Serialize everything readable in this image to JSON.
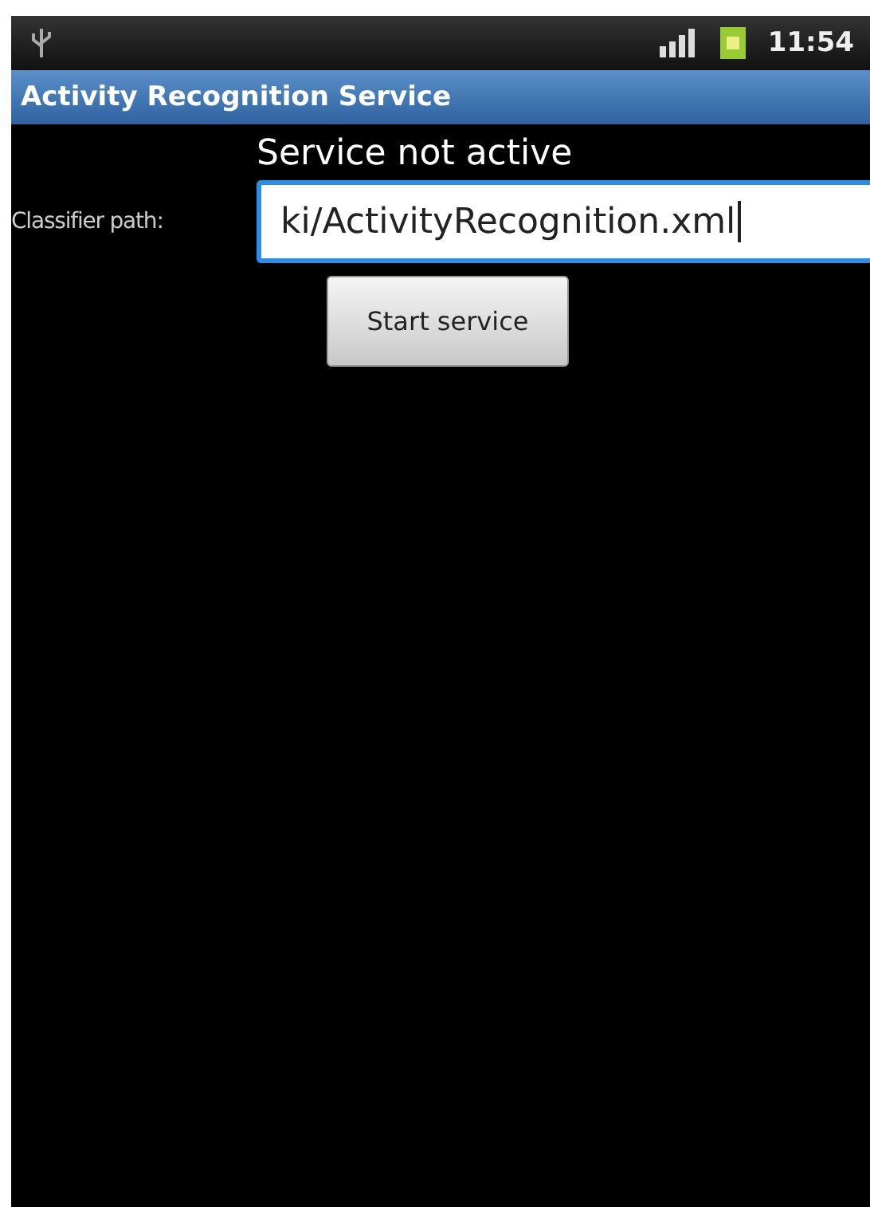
{
  "status_bar": {
    "time": "11:54"
  },
  "window": {
    "title": "Activity Recognition Service"
  },
  "service_status": "Service not active",
  "classifier": {
    "label": "Classifier path:",
    "value": "ki/ActivityRecognition.xml",
    "focused": true
  },
  "buttons": [
    "Start service"
  ]
}
